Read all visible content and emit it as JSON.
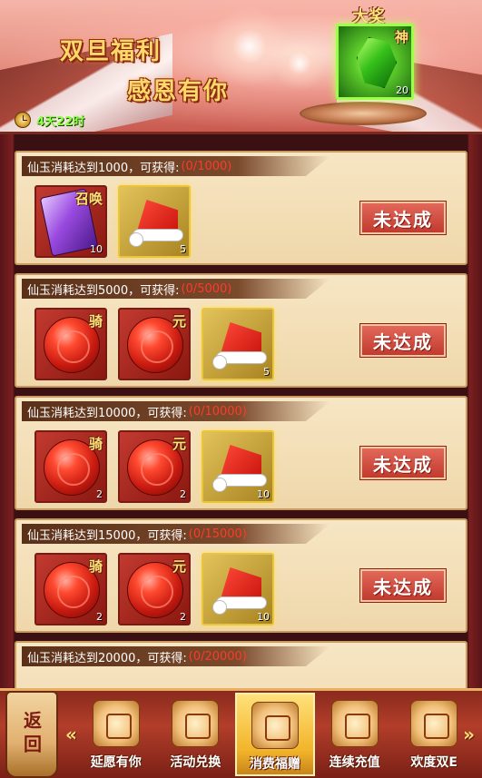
{
  "banner": {
    "title_line1": "双旦福利",
    "title_line2": "感恩有你",
    "timer": "4天22时",
    "grand_prize_label": "大奖",
    "grand_prize_tag": "神",
    "grand_prize_count": "20"
  },
  "rewards": [
    {
      "requirement": "仙玉消耗达到1000，可获得:",
      "progress": "(0/1000)",
      "status": "未达成",
      "items": [
        {
          "kind": "scroll",
          "tag": "召唤",
          "count": "10",
          "frame": "red"
        },
        {
          "kind": "hat",
          "tag": "",
          "count": "5",
          "frame": "gold"
        }
      ]
    },
    {
      "requirement": "仙玉消耗达到5000，可获得:",
      "progress": "(0/5000)",
      "status": "未达成",
      "items": [
        {
          "kind": "orb",
          "tag": "骑",
          "count": "",
          "frame": "red"
        },
        {
          "kind": "orb",
          "tag": "元",
          "count": "",
          "frame": "red"
        },
        {
          "kind": "hat",
          "tag": "",
          "count": "5",
          "frame": "gold"
        }
      ]
    },
    {
      "requirement": "仙玉消耗达到10000，可获得:",
      "progress": "(0/10000)",
      "status": "未达成",
      "items": [
        {
          "kind": "orb",
          "tag": "骑",
          "count": "2",
          "frame": "red"
        },
        {
          "kind": "orb",
          "tag": "元",
          "count": "2",
          "frame": "red"
        },
        {
          "kind": "hat",
          "tag": "",
          "count": "10",
          "frame": "gold"
        }
      ]
    },
    {
      "requirement": "仙玉消耗达到15000，可获得:",
      "progress": "(0/15000)",
      "status": "未达成",
      "items": [
        {
          "kind": "orb",
          "tag": "骑",
          "count": "2",
          "frame": "red"
        },
        {
          "kind": "orb",
          "tag": "元",
          "count": "2",
          "frame": "red"
        },
        {
          "kind": "hat",
          "tag": "",
          "count": "10",
          "frame": "gold"
        }
      ]
    },
    {
      "requirement": "仙玉消耗达到20000，可获得:",
      "progress": "(0/20000)",
      "status": "",
      "items": []
    }
  ],
  "nav": {
    "back_label": "返回",
    "prev_arrow": "«",
    "next_arrow": "»",
    "tabs": [
      {
        "label": "延愿有你",
        "active": false
      },
      {
        "label": "活动兑换",
        "active": false
      },
      {
        "label": "消费福赠",
        "active": true
      },
      {
        "label": "连续充值",
        "active": false
      },
      {
        "label": "欢度双E",
        "active": false
      }
    ]
  }
}
